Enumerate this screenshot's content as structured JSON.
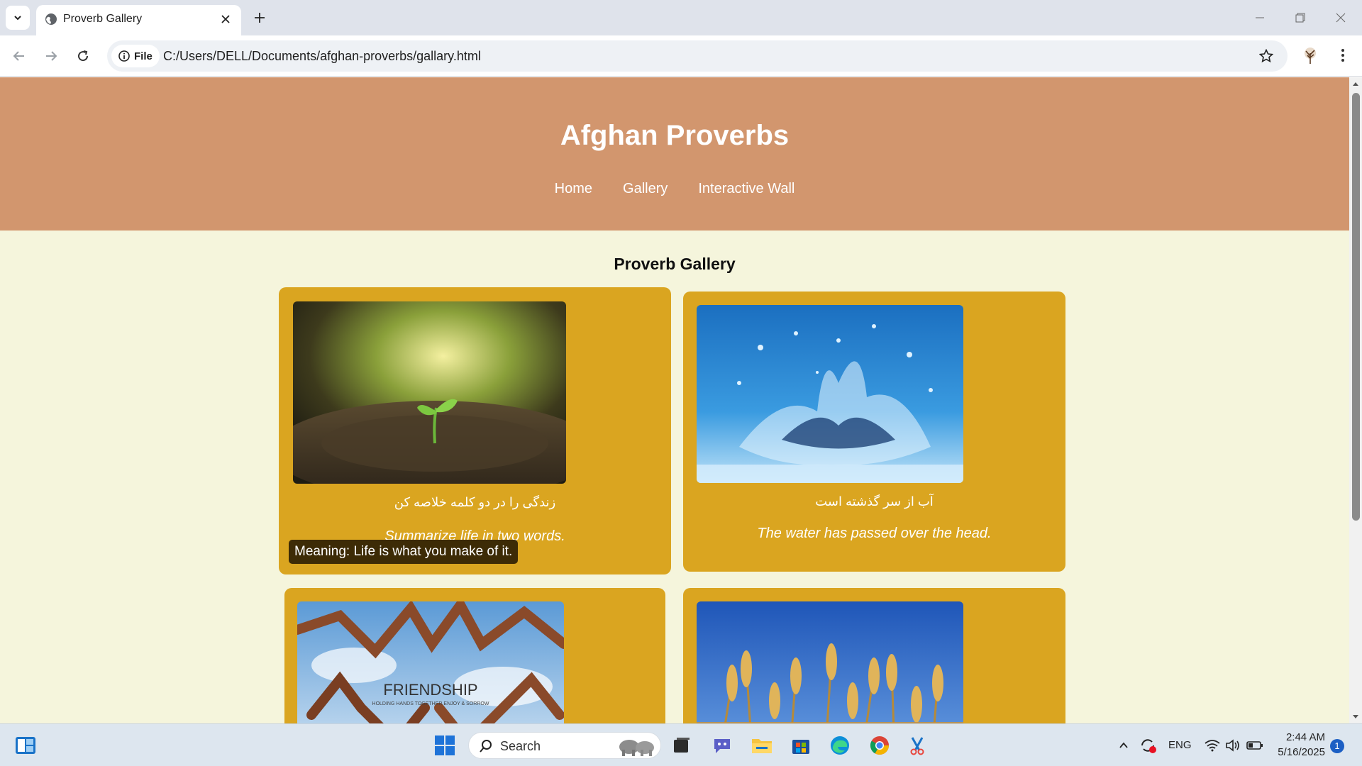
{
  "browser": {
    "tab_title": "Proverb Gallery",
    "site_chip_label": "File",
    "url": "C:/Users/DELL/Documents/afghan-proverbs/gallary.html"
  },
  "page": {
    "site_title": "Afghan Proverbs",
    "nav": [
      "Home",
      "Gallery",
      "Interactive Wall"
    ],
    "gallery_heading": "Proverb Gallery",
    "cards": [
      {
        "image": "sprout-on-tree-stump",
        "persian": "زندگی را در دو کلمه خلاصه کن",
        "english": "Summarize life in two words.",
        "tooltip": "Meaning: Life is what you make of it."
      },
      {
        "image": "water-splash",
        "persian": "آب از سر گذشته است",
        "english": "The water has passed over the head."
      },
      {
        "image": "friendship-hands",
        "image_text": "FRIENDSHIP",
        "image_subtext": "HOLDING HANDS TOGETHER ENJOY & SORROW"
      },
      {
        "image": "wheat-field"
      }
    ]
  },
  "taskbar": {
    "search_placeholder": "Search",
    "language": "ENG",
    "time": "2:44 AM",
    "date": "5/16/2025",
    "notification_count": "1"
  }
}
